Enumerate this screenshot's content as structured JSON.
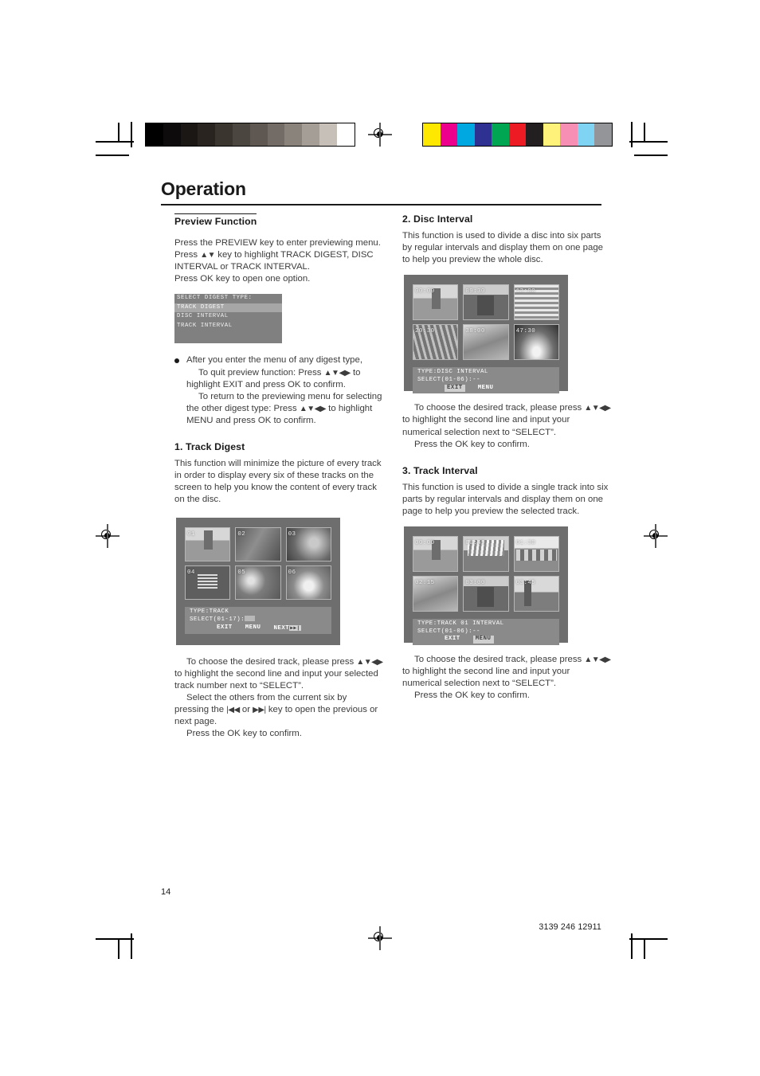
{
  "document": {
    "header_title": "Operation",
    "page_number": "14",
    "doc_code": "3139 246 12911"
  },
  "calibration": {
    "grayscale": [
      "#000000",
      "#0d0b0b",
      "#1b1715",
      "#2a2421",
      "#3b3530",
      "#4c4641",
      "#5f5852",
      "#736c66",
      "#8a837c",
      "#a59e97",
      "#c6c0b9",
      "#ffffff"
    ],
    "colors": [
      "#ffe800",
      "#ec008c",
      "#00a8e1",
      "#2e3192",
      "#00a651",
      "#ed1c24",
      "#231f20",
      "#fff27a",
      "#f78fb5",
      "#7fd4f4",
      "#939598"
    ]
  },
  "left_column": {
    "section_title": "Preview Function",
    "intro_line1": "Press the PREVIEW key to enter previewing menu.",
    "intro_line2_a": "Press ",
    "intro_line2_arrows": "▲▼",
    "intro_line2_b": " key to highlight TRACK DIGEST, DISC INTERVAL or TRACK INTERVAL.",
    "intro_line3": "Press OK  key to open one option.",
    "osd_menu": {
      "title": "SELECT DIGEST TYPE:",
      "items": [
        {
          "label": "TRACK DIGEST",
          "highlighted": true
        },
        {
          "label": "DISC INTERVAL",
          "highlighted": false
        },
        {
          "label": "TRACK INTERVAL",
          "highlighted": false
        }
      ]
    },
    "bullet": {
      "line1": "After you enter the menu of any digest type,",
      "line2_a": "To quit preview function: Press ",
      "arrows4": "▲▼◀▶",
      "line2_b": " to highlight EXIT and press OK to confirm.",
      "line3_a": "To return to the previewing menu for selecting the other digest type: Press ",
      "line3_b": " to highlight MENU and press OK to confirm."
    },
    "track_digest": {
      "heading": "1.  Track Digest",
      "body": "This function will minimize the picture of every track in order to display every six of these tracks on the screen to help you know the content of every track on the disc.",
      "screen": {
        "thumbnails": [
          "01",
          "02",
          "03",
          "04",
          "05",
          "06"
        ],
        "type_line": "TYPE:TRACK",
        "select_line": "SELECT(01-17):",
        "buttons": [
          "EXIT",
          "MENU",
          "NEXT"
        ],
        "next_icon": "▶▶|",
        "highlighted_button": ""
      },
      "after_a": "To choose the desired track, please press ",
      "after_b": " to highlight the second line and input your selected track number next to “SELECT”.",
      "after2_a": "Select the others from the current six by pressing the ",
      "prev_icon": "|◀◀",
      "after2_mid": " or ",
      "next_icon": "▶▶|",
      "after2_b": "  key to open the previous or next page.",
      "after3": "Press the OK key to confirm."
    }
  },
  "right_column": {
    "disc_interval": {
      "heading": "2.  Disc Interval",
      "body": "This function is used to divide a disc into six parts by regular intervals and display them on one page to help you preview the whole disc.",
      "screen": {
        "thumbnails": [
          "00:00",
          "09:30",
          "13:00",
          "20:30",
          "38:00",
          "47:30"
        ],
        "type_line": "TYPE:DISC INTERVAL",
        "select_line": "SELECT(01-06):--",
        "buttons": [
          "EXIT",
          "MENU"
        ],
        "highlighted_button": "EXIT"
      },
      "after_a": "To choose the desired track, please press ",
      "arrows4": "▲▼◀▶",
      "after_b": " to highlight the second line and input your numerical selection next to “SELECT”.",
      "after2": "Press the OK key to confirm."
    },
    "track_interval": {
      "heading": "3.  Track Interval",
      "body": "This function is used to divide a single track into six parts by regular intervals and display them on one page to help you preview the selected track.",
      "screen": {
        "thumbnails": [
          "00:00",
          "00:45",
          "01:30",
          "02:15",
          "03:00",
          "03:45"
        ],
        "type_line": "TYPE:TRACK 01 INTERVAL",
        "select_line": "SELECT(01-06):--",
        "buttons": [
          "EXIT",
          "MENU"
        ],
        "highlighted_button": "MENU"
      },
      "after_a": "To choose the desired track, please press ",
      "after_b": " to highlight the second line and input your numerical selection next to “SELECT”.",
      "after2": "Press the OK key to confirm."
    }
  }
}
